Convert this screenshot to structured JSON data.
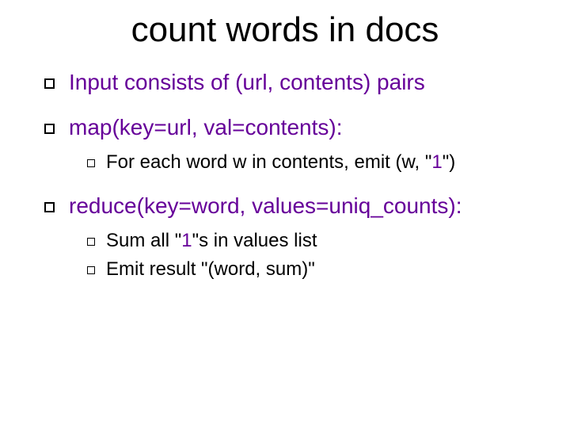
{
  "title": "count words in docs",
  "items": {
    "p1": "Input consists of (url, contents) pairs",
    "p2": "map(key=url, val=contents):",
    "p2a_pre": "For each word w in contents, emit (w, \"",
    "p2a_num": "1",
    "p2a_post": "\")",
    "p3": "reduce(key=word, values=uniq_counts):",
    "p3a_pre": "Sum all \"",
    "p3a_num": "1",
    "p3a_post": "\"s in values list",
    "p3b": "Emit result \"(word, sum)\""
  }
}
